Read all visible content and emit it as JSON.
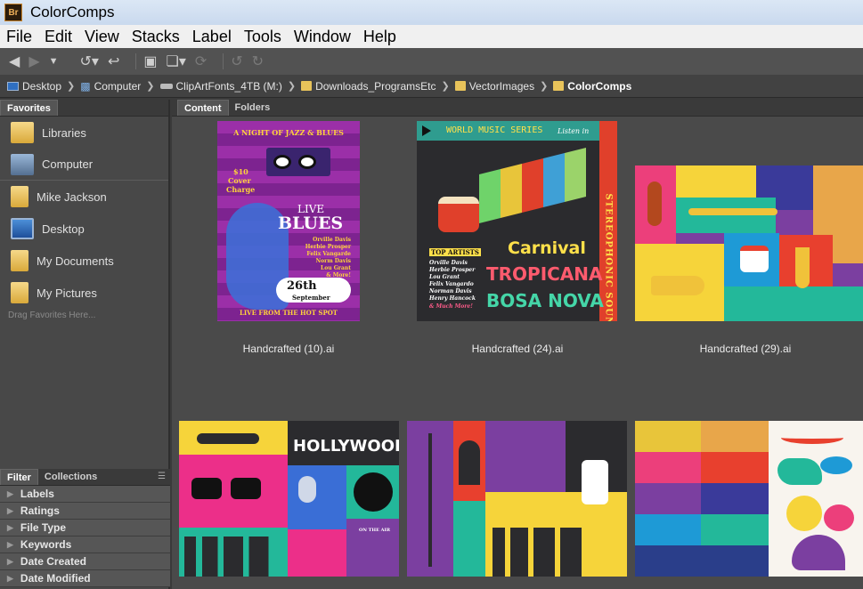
{
  "window": {
    "title": "ColorComps",
    "app_badge": "Br"
  },
  "menu": [
    "File",
    "Edit",
    "View",
    "Stacks",
    "Label",
    "Tools",
    "Window",
    "Help"
  ],
  "path": [
    {
      "label": "Desktop",
      "icon": "desktop-icon"
    },
    {
      "label": "Computer",
      "icon": "computer-icon"
    },
    {
      "label": "ClipArtFonts_4TB (M:)",
      "icon": "drive-icon"
    },
    {
      "label": "Downloads_ProgramsEtc",
      "icon": "folder-icon"
    },
    {
      "label": "VectorImages",
      "icon": "folder-icon"
    },
    {
      "label": "ColorComps",
      "icon": "folder-icon"
    }
  ],
  "left_tabs": {
    "favorites": "Favorites"
  },
  "favorites": [
    {
      "label": "Libraries",
      "icon": "libraries-icon"
    },
    {
      "label": "Computer",
      "icon": "computer-icon"
    },
    {
      "label": "Mike Jackson",
      "icon": "user-folder-icon"
    },
    {
      "label": "Desktop",
      "icon": "desktop-icon"
    },
    {
      "label": "My Documents",
      "icon": "documents-icon"
    },
    {
      "label": "My Pictures",
      "icon": "pictures-icon"
    }
  ],
  "drag_hint": "Drag Favorites Here...",
  "filter_tabs": {
    "filter": "Filter",
    "collections": "Collections"
  },
  "filters": [
    "Labels",
    "Ratings",
    "File Type",
    "Keywords",
    "Date Created",
    "Date Modified"
  ],
  "content_tabs": {
    "content": "Content",
    "folders": "Folders"
  },
  "thumbnails": [
    {
      "caption": "Handcrafted (10).ai",
      "texts": [
        "A NIGHT OF JAZZ & BLUES",
        "$10",
        "Cover",
        "Charge",
        "LIVE",
        "BLUES",
        "Orville Davis",
        "Herbie Prosper",
        "Felix Vangarde",
        "Norm Davis",
        "Lou Grant",
        "& More!",
        "26th",
        "September",
        "LIVE FROM THE HOT SPOT"
      ]
    },
    {
      "caption": "Handcrafted (24).ai",
      "texts": [
        "WORLD MUSIC SERIES",
        "Listen in",
        "STEREOPHONIC SOUND",
        "TOP ARTISTS",
        "Orville Davis",
        "Herbie Prosper",
        "Lou Grant",
        "Felix Vangardo",
        "Norman Davis",
        "Henry Hancock",
        "& Much More!",
        "Carnival",
        "TROPICANA",
        "BOSA NOVA"
      ]
    },
    {
      "caption": "Handcrafted (29).ai",
      "texts": []
    },
    {
      "caption": "",
      "texts": [
        "HOLLYWOOD",
        "ON THE AIR"
      ]
    },
    {
      "caption": "",
      "texts": []
    },
    {
      "caption": "",
      "texts": []
    }
  ]
}
